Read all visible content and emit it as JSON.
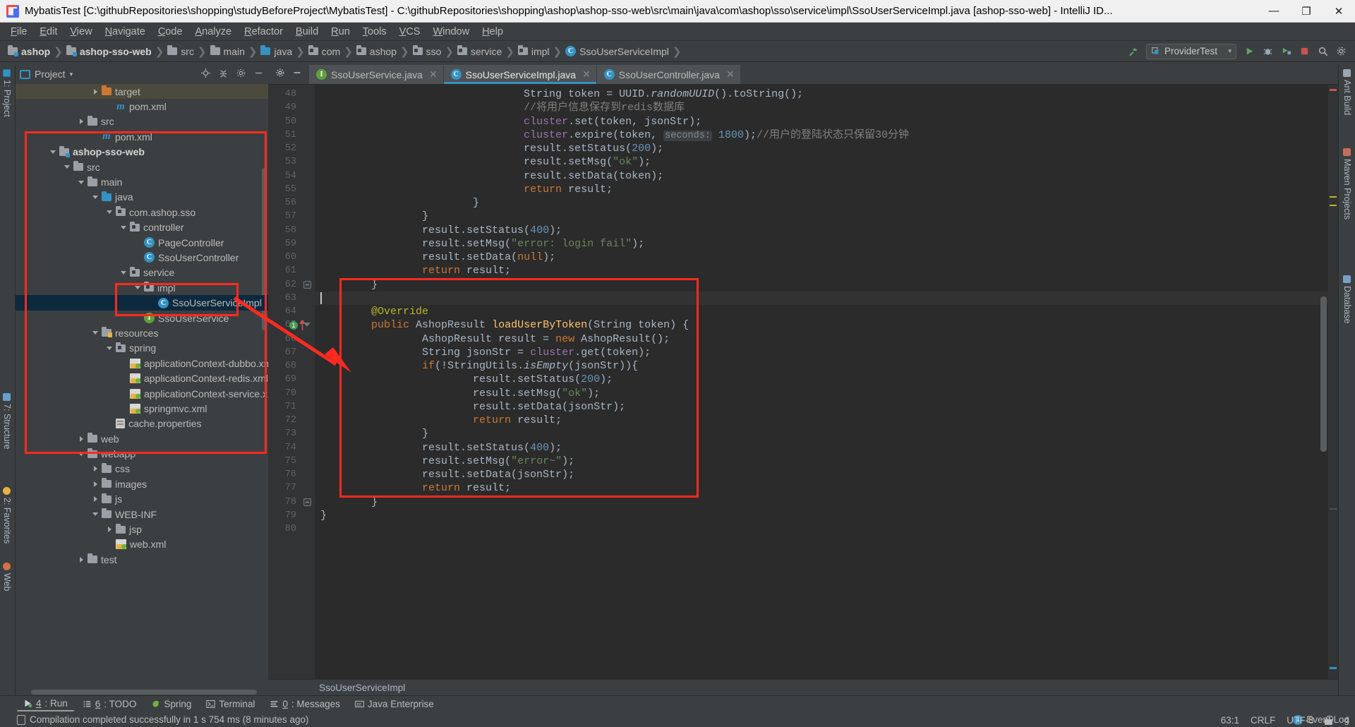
{
  "window": {
    "title": "MybatisTest [C:\\githubRepositories\\shopping\\studyBeforeProject\\MybatisTest] - C:\\githubRepositories\\shopping\\ashop\\ashop-sso-web\\src\\main\\java\\com\\ashop\\sso\\service\\impl\\SsoUserServiceImpl.java [ashop-sso-web] - IntelliJ ID...",
    "minimize": "—",
    "maximize": "❐",
    "close": "✕"
  },
  "menubar": {
    "items": [
      "File",
      "Edit",
      "View",
      "Navigate",
      "Code",
      "Analyze",
      "Refactor",
      "Build",
      "Run",
      "Tools",
      "VCS",
      "Window",
      "Help"
    ]
  },
  "navbar": {
    "crumbs": [
      {
        "label": "ashop",
        "icon": "module-folder-icon",
        "bold": true
      },
      {
        "label": "ashop-sso-web",
        "icon": "module-folder-icon",
        "bold": true
      },
      {
        "label": "src",
        "icon": "folder-icon",
        "bold": false
      },
      {
        "label": "main",
        "icon": "folder-icon",
        "bold": false
      },
      {
        "label": "java",
        "icon": "source-folder-icon",
        "bold": false
      },
      {
        "label": "com",
        "icon": "package-icon",
        "bold": false
      },
      {
        "label": "ashop",
        "icon": "package-icon",
        "bold": false
      },
      {
        "label": "sso",
        "icon": "package-icon",
        "bold": false
      },
      {
        "label": "service",
        "icon": "package-icon",
        "bold": false
      },
      {
        "label": "impl",
        "icon": "package-icon",
        "bold": false
      },
      {
        "label": "SsoUserServiceImpl",
        "icon": "class-icon",
        "bold": false
      }
    ],
    "run_config": "ProviderTest",
    "run_config_caret": "▾",
    "buttons": [
      "build-hammer-icon",
      "run-icon",
      "debug-icon",
      "run-coverage-icon",
      "stop-icon",
      "search-everywhere-icon",
      "settings-icon"
    ]
  },
  "project_panel": {
    "title": "Project",
    "title_caret": "▾",
    "action_icons": [
      "locate-icon",
      "collapse-all-icon",
      "settings-gear-icon",
      "hide-icon"
    ],
    "tree": [
      {
        "label": "target",
        "depth": 5,
        "icon": "folder-orange-icon",
        "arrow": "right",
        "state": "hover"
      },
      {
        "label": "pom.xml",
        "depth": 6,
        "icon": "maven-icon",
        "arrow": "none",
        "state": ""
      },
      {
        "label": "src",
        "depth": 4,
        "icon": "folder-icon",
        "arrow": "right",
        "state": ""
      },
      {
        "label": "pom.xml",
        "depth": 5,
        "icon": "maven-icon",
        "arrow": "none",
        "state": ""
      },
      {
        "label": "ashop-sso-web",
        "depth": 2,
        "icon": "module-folder-icon",
        "arrow": "down",
        "state": "",
        "bold": true
      },
      {
        "label": "src",
        "depth": 3,
        "icon": "folder-icon",
        "arrow": "down",
        "state": ""
      },
      {
        "label": "main",
        "depth": 4,
        "icon": "folder-icon",
        "arrow": "down",
        "state": ""
      },
      {
        "label": "java",
        "depth": 5,
        "icon": "source-folder-icon",
        "arrow": "down",
        "state": ""
      },
      {
        "label": "com.ashop.sso",
        "depth": 6,
        "icon": "package-icon",
        "arrow": "down",
        "state": ""
      },
      {
        "label": "controller",
        "depth": 7,
        "icon": "package-icon",
        "arrow": "down",
        "state": ""
      },
      {
        "label": "PageController",
        "depth": 8,
        "icon": "class-icon",
        "arrow": "none",
        "state": ""
      },
      {
        "label": "SsoUserController",
        "depth": 8,
        "icon": "class-icon",
        "arrow": "none",
        "state": ""
      },
      {
        "label": "service",
        "depth": 7,
        "icon": "package-icon",
        "arrow": "down",
        "state": ""
      },
      {
        "label": "impl",
        "depth": 8,
        "icon": "package-icon",
        "arrow": "down",
        "state": ""
      },
      {
        "label": "SsoUserServiceImpl",
        "depth": 9,
        "icon": "class-icon",
        "arrow": "none",
        "state": "selected"
      },
      {
        "label": "SsoUserService",
        "depth": 8,
        "icon": "interface-icon",
        "arrow": "none",
        "state": ""
      },
      {
        "label": "resources",
        "depth": 5,
        "icon": "resources-folder-icon",
        "arrow": "down",
        "state": ""
      },
      {
        "label": "spring",
        "depth": 6,
        "icon": "package-icon",
        "arrow": "down",
        "state": ""
      },
      {
        "label": "applicationContext-dubbo.xml",
        "depth": 7,
        "icon": "spring-xml-icon",
        "arrow": "none",
        "state": ""
      },
      {
        "label": "applicationContext-redis.xml",
        "depth": 7,
        "icon": "spring-xml-icon",
        "arrow": "none",
        "state": ""
      },
      {
        "label": "applicationContext-service.xml",
        "depth": 7,
        "icon": "spring-xml-icon",
        "arrow": "none",
        "state": ""
      },
      {
        "label": "springmvc.xml",
        "depth": 7,
        "icon": "spring-xml-icon",
        "arrow": "none",
        "state": ""
      },
      {
        "label": "cache.properties",
        "depth": 6,
        "icon": "properties-icon",
        "arrow": "none",
        "state": ""
      },
      {
        "label": "web",
        "depth": 4,
        "icon": "folder-icon",
        "arrow": "right",
        "state": ""
      },
      {
        "label": "webapp",
        "depth": 4,
        "icon": "folder-icon",
        "arrow": "down",
        "state": ""
      },
      {
        "label": "css",
        "depth": 5,
        "icon": "folder-icon",
        "arrow": "right",
        "state": ""
      },
      {
        "label": "images",
        "depth": 5,
        "icon": "folder-icon",
        "arrow": "right",
        "state": ""
      },
      {
        "label": "js",
        "depth": 5,
        "icon": "folder-icon",
        "arrow": "right",
        "state": ""
      },
      {
        "label": "WEB-INF",
        "depth": 5,
        "icon": "folder-icon",
        "arrow": "down",
        "state": ""
      },
      {
        "label": "jsp",
        "depth": 6,
        "icon": "folder-icon",
        "arrow": "right",
        "state": ""
      },
      {
        "label": "web.xml",
        "depth": 6,
        "icon": "xml-icon",
        "arrow": "none",
        "state": ""
      },
      {
        "label": "test",
        "depth": 4,
        "icon": "folder-icon",
        "arrow": "right",
        "state": ""
      }
    ]
  },
  "left_strip": {
    "tabs": [
      "1: Project",
      "7: Structure",
      "2: Favorites",
      "Web"
    ]
  },
  "right_strip": {
    "tabs": [
      "Ant Build",
      "Maven Projects",
      "Database"
    ]
  },
  "editor": {
    "tabs": [
      {
        "label": "SsoUserService.java",
        "icon": "interface-icon",
        "active": false,
        "close": "✕"
      },
      {
        "label": "SsoUserServiceImpl.java",
        "icon": "class-icon",
        "active": true,
        "close": "✕"
      },
      {
        "label": "SsoUserController.java",
        "icon": "class-icon",
        "active": false,
        "close": "✕"
      }
    ],
    "tab_tools": [
      "settings-gear-icon",
      "hide-icon"
    ],
    "breadcrumb": "SsoUserServiceImpl",
    "first_line_number": 48,
    "lines": [
      {
        "n": 48,
        "indent": 8,
        "tokens": [
          {
            "t": "String ",
            "c": "plain"
          },
          {
            "t": "token ",
            "c": "plain"
          },
          {
            "t": "= ",
            "c": "plain"
          },
          {
            "t": "UUID",
            "c": "plain"
          },
          {
            "t": ".",
            "c": "plain"
          },
          {
            "t": "randomUUID",
            "c": "italic"
          },
          {
            "t": "().",
            "c": "plain"
          },
          {
            "t": "toString",
            "c": "plain"
          },
          {
            "t": "();",
            "c": "plain"
          }
        ]
      },
      {
        "n": 49,
        "indent": 8,
        "tokens": [
          {
            "t": "//将用户信息保存到redis数据库",
            "c": "comment"
          }
        ]
      },
      {
        "n": 50,
        "indent": 8,
        "tokens": [
          {
            "t": "cluster",
            "c": "field"
          },
          {
            "t": ".set(token, jsonStr);",
            "c": "plain"
          }
        ]
      },
      {
        "n": 51,
        "indent": 8,
        "tokens": [
          {
            "t": "cluster",
            "c": "field"
          },
          {
            "t": ".expire(token, ",
            "c": "plain"
          },
          {
            "t": "seconds:",
            "c": "hint"
          },
          {
            "t": " ",
            "c": "plain"
          },
          {
            "t": "1800",
            "c": "number"
          },
          {
            "t": ");",
            "c": "plain"
          },
          {
            "t": "//用户的登陆状态只保留30分钟",
            "c": "comment"
          }
        ]
      },
      {
        "n": 52,
        "indent": 8,
        "tokens": [
          {
            "t": "result.setStatus(",
            "c": "plain"
          },
          {
            "t": "200",
            "c": "number"
          },
          {
            "t": ");",
            "c": "plain"
          }
        ]
      },
      {
        "n": 53,
        "indent": 8,
        "tokens": [
          {
            "t": "result.setMsg(",
            "c": "plain"
          },
          {
            "t": "\"ok\"",
            "c": "string"
          },
          {
            "t": ");",
            "c": "plain"
          }
        ]
      },
      {
        "n": 54,
        "indent": 8,
        "tokens": [
          {
            "t": "result.setData(token);",
            "c": "plain"
          }
        ]
      },
      {
        "n": 55,
        "indent": 8,
        "tokens": [
          {
            "t": "return",
            "c": "keyword"
          },
          {
            "t": " result;",
            "c": "plain"
          }
        ]
      },
      {
        "n": 56,
        "indent": 6,
        "tokens": [
          {
            "t": "}",
            "c": "plain"
          }
        ]
      },
      {
        "n": 57,
        "indent": 4,
        "tokens": [
          {
            "t": "}",
            "c": "plain"
          }
        ]
      },
      {
        "n": 58,
        "indent": 4,
        "tokens": [
          {
            "t": "result.setStatus(",
            "c": "plain"
          },
          {
            "t": "400",
            "c": "number"
          },
          {
            "t": ");",
            "c": "plain"
          }
        ]
      },
      {
        "n": 59,
        "indent": 4,
        "tokens": [
          {
            "t": "result.setMsg(",
            "c": "plain"
          },
          {
            "t": "\"error: login fail\"",
            "c": "string"
          },
          {
            "t": ");",
            "c": "plain"
          }
        ]
      },
      {
        "n": 60,
        "indent": 4,
        "tokens": [
          {
            "t": "result.setData(",
            "c": "plain"
          },
          {
            "t": "null",
            "c": "keyword"
          },
          {
            "t": ");",
            "c": "plain"
          }
        ]
      },
      {
        "n": 61,
        "indent": 4,
        "tokens": [
          {
            "t": "return",
            "c": "keyword"
          },
          {
            "t": " result;",
            "c": "plain"
          }
        ]
      },
      {
        "n": 62,
        "indent": 2,
        "tokens": [
          {
            "t": "}",
            "c": "plain"
          }
        ]
      },
      {
        "n": 63,
        "indent": 0,
        "tokens": []
      },
      {
        "n": 64,
        "indent": 2,
        "tokens": [
          {
            "t": "@Override",
            "c": "annotation"
          }
        ]
      },
      {
        "n": 65,
        "indent": 2,
        "tokens": [
          {
            "t": "public",
            "c": "keyword"
          },
          {
            "t": " AshopResult ",
            "c": "plain"
          },
          {
            "t": "loadUserByToken",
            "c": "method"
          },
          {
            "t": "(String token) {",
            "c": "plain"
          }
        ]
      },
      {
        "n": 66,
        "indent": 4,
        "tokens": [
          {
            "t": "AshopResult result = ",
            "c": "plain"
          },
          {
            "t": "new",
            "c": "keyword"
          },
          {
            "t": " AshopResult();",
            "c": "plain"
          }
        ]
      },
      {
        "n": 67,
        "indent": 4,
        "tokens": [
          {
            "t": "String jsonStr = ",
            "c": "plain"
          },
          {
            "t": "cluster",
            "c": "field"
          },
          {
            "t": ".get(token);",
            "c": "plain"
          }
        ]
      },
      {
        "n": 68,
        "indent": 4,
        "tokens": [
          {
            "t": "if",
            "c": "keyword"
          },
          {
            "t": "(!StringUtils.",
            "c": "plain"
          },
          {
            "t": "isEmpty",
            "c": "italic"
          },
          {
            "t": "(jsonStr)){",
            "c": "plain"
          }
        ]
      },
      {
        "n": 69,
        "indent": 6,
        "tokens": [
          {
            "t": "result.setStatus(",
            "c": "plain"
          },
          {
            "t": "200",
            "c": "number"
          },
          {
            "t": ");",
            "c": "plain"
          }
        ]
      },
      {
        "n": 70,
        "indent": 6,
        "tokens": [
          {
            "t": "result.setMsg(",
            "c": "plain"
          },
          {
            "t": "\"ok\"",
            "c": "string"
          },
          {
            "t": ");",
            "c": "plain"
          }
        ]
      },
      {
        "n": 71,
        "indent": 6,
        "tokens": [
          {
            "t": "result.setData(jsonStr);",
            "c": "plain"
          }
        ]
      },
      {
        "n": 72,
        "indent": 6,
        "tokens": [
          {
            "t": "return",
            "c": "keyword"
          },
          {
            "t": " result;",
            "c": "plain"
          }
        ]
      },
      {
        "n": 73,
        "indent": 4,
        "tokens": [
          {
            "t": "}",
            "c": "plain"
          }
        ]
      },
      {
        "n": 74,
        "indent": 4,
        "tokens": [
          {
            "t": "result.setStatus(",
            "c": "plain"
          },
          {
            "t": "400",
            "c": "number"
          },
          {
            "t": ");",
            "c": "plain"
          }
        ]
      },
      {
        "n": 75,
        "indent": 4,
        "tokens": [
          {
            "t": "result.setMsg(",
            "c": "plain"
          },
          {
            "t": "\"error~\"",
            "c": "string"
          },
          {
            "t": ");",
            "c": "plain"
          }
        ]
      },
      {
        "n": 76,
        "indent": 4,
        "tokens": [
          {
            "t": "result.setData(jsonStr);",
            "c": "plain"
          }
        ]
      },
      {
        "n": 77,
        "indent": 4,
        "tokens": [
          {
            "t": "return",
            "c": "keyword"
          },
          {
            "t": " result;",
            "c": "plain"
          }
        ]
      },
      {
        "n": 78,
        "indent": 2,
        "tokens": [
          {
            "t": "}",
            "c": "plain"
          }
        ]
      },
      {
        "n": 79,
        "indent": 0,
        "tokens": [
          {
            "t": "}",
            "c": "plain"
          }
        ]
      },
      {
        "n": 80,
        "indent": 0,
        "tokens": []
      }
    ],
    "gutter_marker_line": 65,
    "gutter_marker_badge": "1"
  },
  "bottom_tabs": [
    {
      "accel": "4",
      "label": ": Run",
      "icon": "run-icon",
      "active": true
    },
    {
      "accel": "6",
      "label": ": TODO",
      "icon": "todo-icon",
      "active": false
    },
    {
      "accel": "",
      "label": "Spring",
      "icon": "spring-icon",
      "active": false
    },
    {
      "accel": "",
      "label": "Terminal",
      "icon": "terminal-icon",
      "active": false
    },
    {
      "accel": "0",
      "label": ": Messages",
      "icon": "messages-icon",
      "active": false
    },
    {
      "accel": "",
      "label": "Java Enterprise",
      "icon": "java-enterprise-icon",
      "active": false
    }
  ],
  "statusbar": {
    "message": "Compilation completed successfully in 1 s 754 ms (8 minutes ago)",
    "event_log": "Event Log",
    "event_count": "1",
    "caret_position": "63:1",
    "line_separator": "CRLF",
    "encoding": "UTF-8",
    "indent": "4",
    "lock_icon": "lock-icon"
  },
  "colors": {
    "accent": "#3592c4",
    "annotation_red": "#ff2a20",
    "keyword": "#cc7832",
    "string": "#6a8759",
    "number": "#6897bb",
    "comment": "#808080",
    "method": "#ffc66d",
    "field": "#9876aa",
    "annotation": "#bbb529",
    "editor_bg": "#2b2b2b",
    "panel_bg": "#3c3f41",
    "selection_bg": "#0d293e"
  }
}
